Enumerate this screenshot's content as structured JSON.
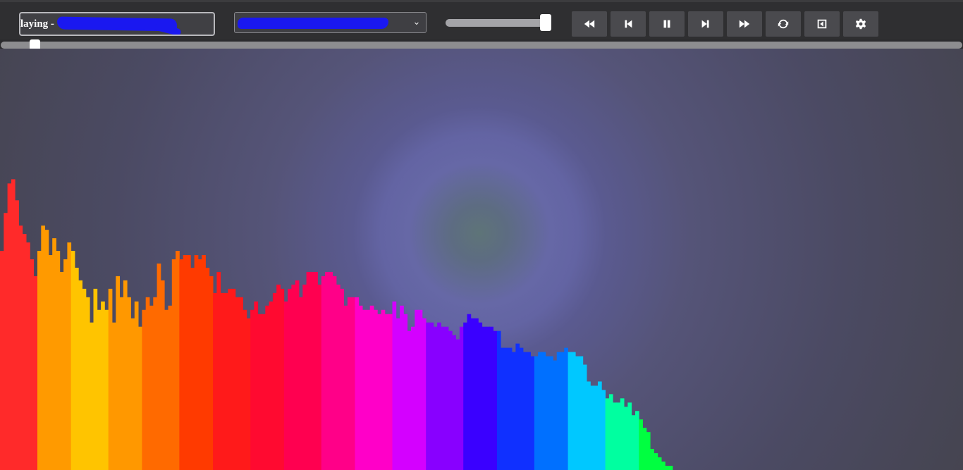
{
  "player": {
    "now_playing_prefix": "laying -",
    "volume": 0.95,
    "progress": 0.04
  },
  "controls": [
    {
      "name": "rewind-button",
      "icon": "rewind-icon"
    },
    {
      "name": "previous-button",
      "icon": "skip-back-icon"
    },
    {
      "name": "pause-button",
      "icon": "pause-icon"
    },
    {
      "name": "next-button",
      "icon": "skip-forward-icon"
    },
    {
      "name": "fast-forward-button",
      "icon": "fast-forward-icon"
    },
    {
      "name": "repeat-button",
      "icon": "refresh-icon"
    },
    {
      "name": "collapse-button",
      "icon": "caret-left-square-icon"
    },
    {
      "name": "settings-button",
      "icon": "gear-icon"
    }
  ],
  "visualizer": {
    "levels": [
      0.52,
      0.61,
      0.68,
      0.69,
      0.64,
      0.58,
      0.56,
      0.54,
      0.5,
      0.46,
      0.52,
      0.58,
      0.57,
      0.51,
      0.55,
      0.52,
      0.47,
      0.5,
      0.54,
      0.52,
      0.48,
      0.45,
      0.43,
      0.41,
      0.35,
      0.43,
      0.38,
      0.4,
      0.38,
      0.43,
      0.35,
      0.46,
      0.41,
      0.45,
      0.41,
      0.36,
      0.4,
      0.34,
      0.38,
      0.41,
      0.39,
      0.41,
      0.49,
      0.45,
      0.38,
      0.39,
      0.5,
      0.52,
      0.5,
      0.51,
      0.51,
      0.48,
      0.51,
      0.5,
      0.51,
      0.48,
      0.46,
      0.42,
      0.47,
      0.42,
      0.42,
      0.43,
      0.43,
      0.41,
      0.41,
      0.38,
      0.36,
      0.38,
      0.4,
      0.37,
      0.37,
      0.39,
      0.4,
      0.42,
      0.44,
      0.43,
      0.4,
      0.43,
      0.44,
      0.45,
      0.41,
      0.44,
      0.47,
      0.47,
      0.47,
      0.44,
      0.46,
      0.47,
      0.47,
      0.46,
      0.44,
      0.43,
      0.39,
      0.41,
      0.41,
      0.41,
      0.39,
      0.38,
      0.38,
      0.39,
      0.38,
      0.37,
      0.38,
      0.37,
      0.37,
      0.4,
      0.36,
      0.39,
      0.37,
      0.33,
      0.34,
      0.38,
      0.38,
      0.36,
      0.35,
      0.35,
      0.34,
      0.35,
      0.34,
      0.34,
      0.33,
      0.32,
      0.31,
      0.34,
      0.35,
      0.37,
      0.36,
      0.36,
      0.35,
      0.34,
      0.34,
      0.34,
      0.33,
      0.33,
      0.29,
      0.29,
      0.29,
      0.28,
      0.3,
      0.29,
      0.28,
      0.28,
      0.27,
      0.27,
      0.28,
      0.28,
      0.27,
      0.27,
      0.26,
      0.28,
      0.28,
      0.29,
      0.28,
      0.28,
      0.27,
      0.27,
      0.25,
      0.21,
      0.2,
      0.2,
      0.21,
      0.19,
      0.17,
      0.18,
      0.16,
      0.16,
      0.17,
      0.15,
      0.16,
      0.13,
      0.14,
      0.12,
      0.1,
      0.09,
      0.05,
      0.04,
      0.03,
      0.02,
      0.01,
      0.01
    ],
    "colors": [
      "#ff2a2a",
      "#ff9a00",
      "#ffc400",
      "#ff9800",
      "#ff6a00",
      "#ff3a00",
      "#ff1a1a",
      "#ff0a30",
      "#ff0050",
      "#ff0088",
      "#ff00c8",
      "#d400ff",
      "#8800ff",
      "#3a00ff",
      "#1030ff",
      "#0070ff",
      "#00c8ff",
      "#00ffa0",
      "#00ff40"
    ]
  }
}
